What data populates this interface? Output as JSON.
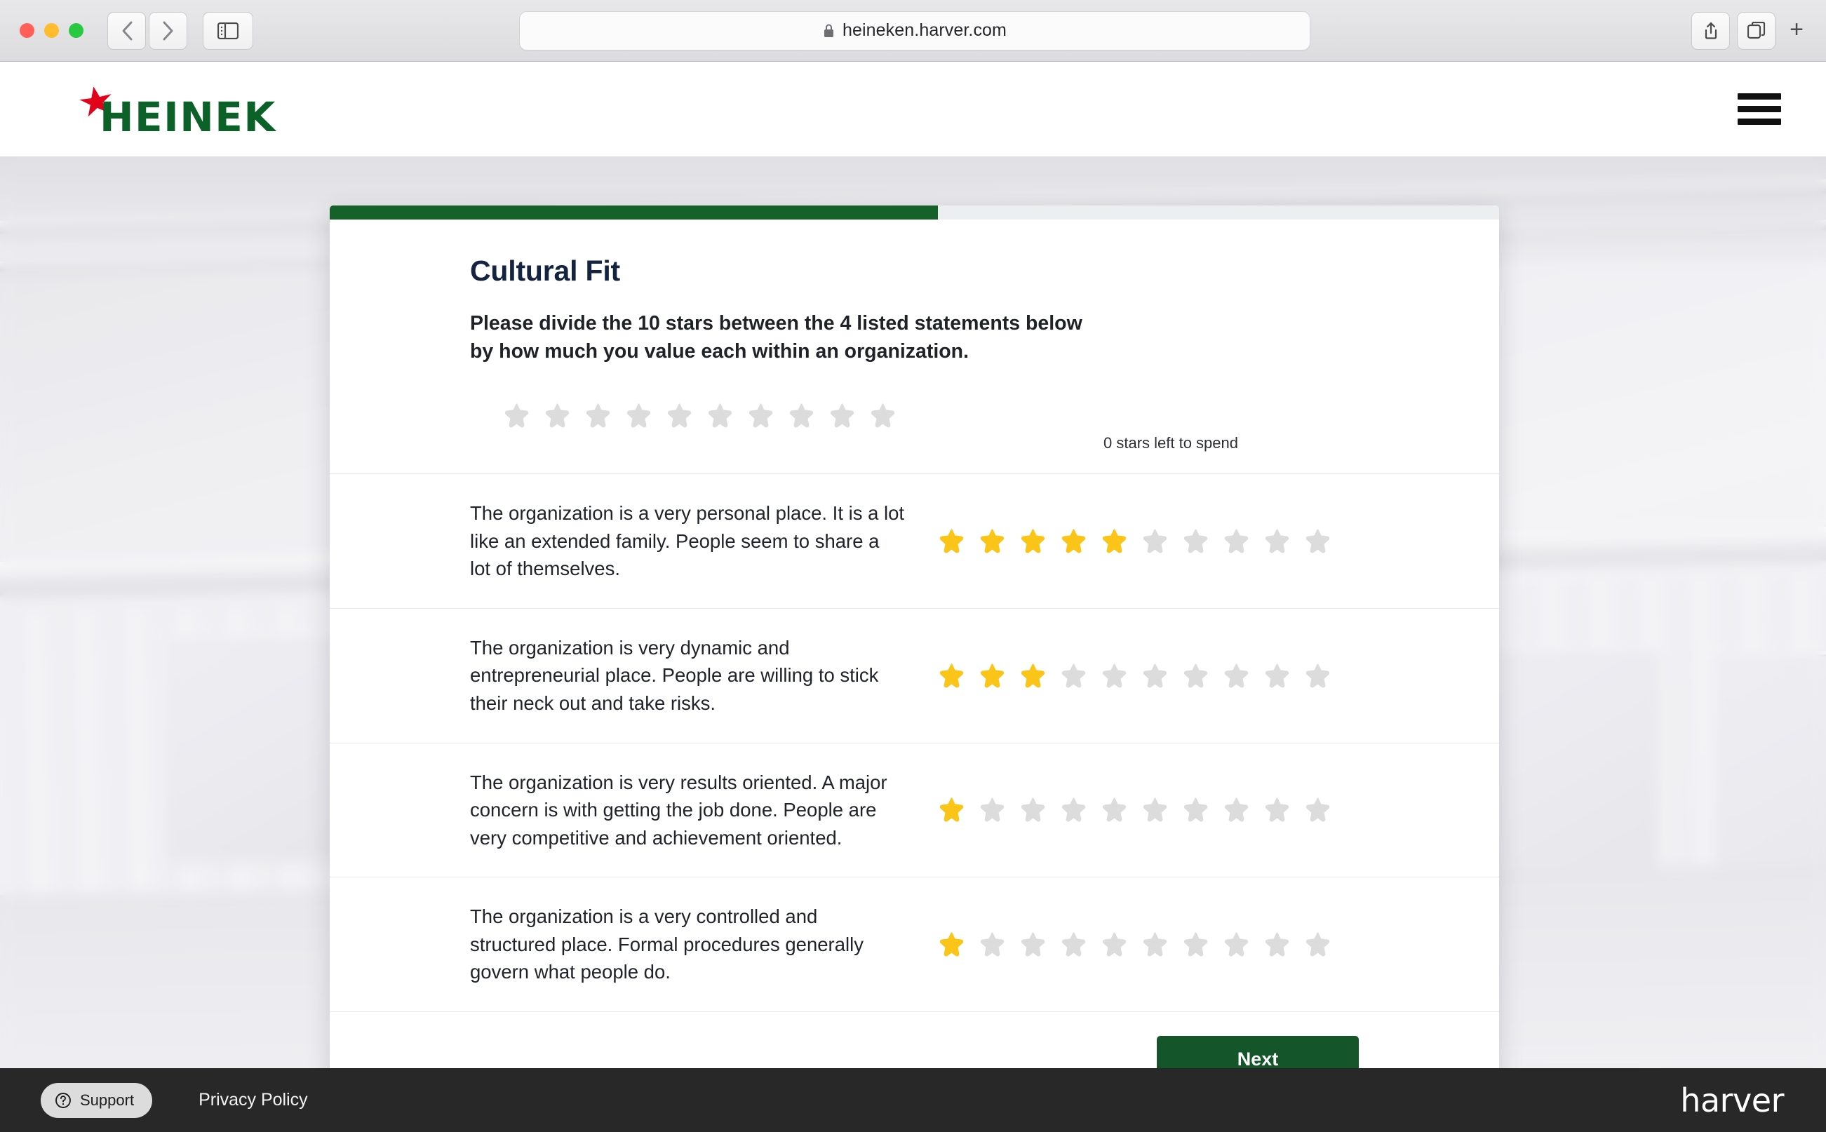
{
  "browser": {
    "url": "heineken.harver.com",
    "back_label": "Back",
    "forward_label": "Forward",
    "sidebar_label": "Sidebar",
    "share_label": "Share",
    "tabs_label": "Tab Overview",
    "new_tab_label": "+"
  },
  "header": {
    "brand": "HEINEKEN",
    "menu_label": "Menu"
  },
  "assessment": {
    "progress_percent": 52,
    "title": "Cultural Fit",
    "instructions": "Please divide the 10 stars between the 4 listed statements below by how much you value each within an organization.",
    "instructions_line1": "Please divide the 10 stars between the 4 listed statements below",
    "instructions_line2": "by how much you value each within an organization.",
    "total_stars": 10,
    "budget_filled": 0,
    "stars_left_label": "0 stars left to spend",
    "statements": [
      {
        "text": "The organization is a very personal place. It is a lot like an extended family. People seem to share a lot of themselves.",
        "rating": 5,
        "max": 10
      },
      {
        "text": "The organization is very dynamic and entrepreneurial place. People are willing to stick their neck out and take risks.",
        "rating": 3,
        "max": 10
      },
      {
        "text": "The organization is very results oriented. A major concern is with getting the job done. People are very competitive and achievement oriented.",
        "rating": 1,
        "max": 10
      },
      {
        "text": "The organization is a very controlled and structured place. Formal procedures generally govern what people do.",
        "rating": 1,
        "max": 10
      }
    ],
    "next_label": "Next"
  },
  "footer": {
    "support_label": "Support",
    "privacy_label": "Privacy Policy",
    "vendor": "harver"
  },
  "colors": {
    "brand_green": "#14612a",
    "button_green": "#14562a",
    "star_filled": "#fbc419",
    "star_empty": "#dcdcdc",
    "title_navy": "#14233f",
    "footer_bg": "#282828",
    "logo_red": "#e3001b",
    "logo_green": "#0b6127"
  }
}
